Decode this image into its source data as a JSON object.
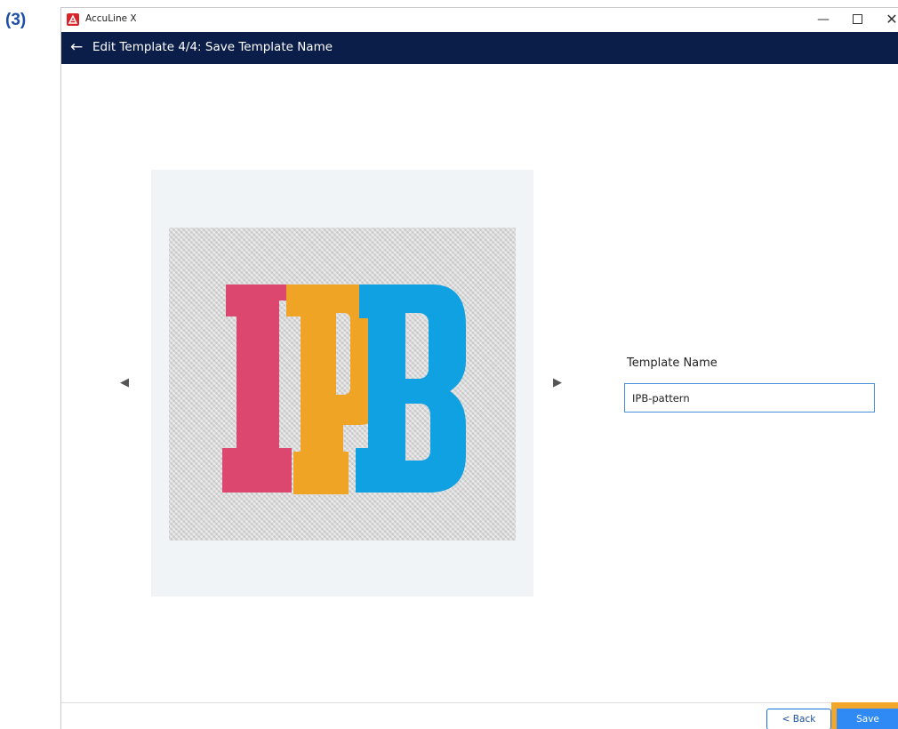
{
  "step_label": "(3)",
  "window": {
    "app_title": "AccuLine X",
    "controls": {
      "minimize": "—",
      "close": "✕"
    }
  },
  "header": {
    "back_icon": "←",
    "title": "Edit Template 4/4: Save Template Name"
  },
  "preview": {
    "image_text": "IPB",
    "prev_icon": "◀",
    "next_icon": "▶"
  },
  "form": {
    "label": "Template Name",
    "value": "IPB-pattern"
  },
  "footer": {
    "back_label": "< Back",
    "save_label": "Save"
  },
  "colors": {
    "header_bg": "#0b1e4a",
    "accent": "#2f8af5",
    "highlight": "#f3a72a",
    "letter_i": "#dc4770",
    "letter_p": "#efa426",
    "letter_b": "#0fa1e2"
  }
}
